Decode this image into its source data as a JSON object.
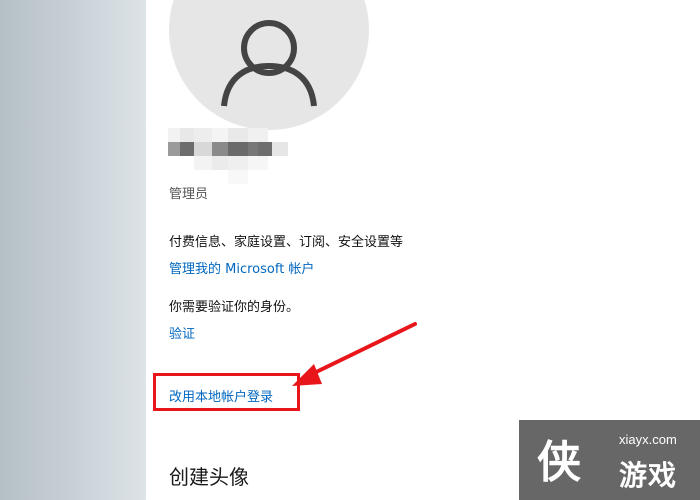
{
  "account": {
    "role": "管理员",
    "info_text": "付费信息、家庭设置、订阅、安全设置等",
    "manage_link": "管理我的 Microsoft 帐户",
    "verify_text": "你需要验证你的身份。",
    "verify_link": "验证",
    "local_account_link": "改用本地帐户登录"
  },
  "section": {
    "create_avatar": "创建头像"
  },
  "watermark": {
    "logo": "侠",
    "url": "xiayx.com",
    "name": "游戏"
  },
  "colors": {
    "link": "#0067c0",
    "highlight": "#e8161b"
  }
}
